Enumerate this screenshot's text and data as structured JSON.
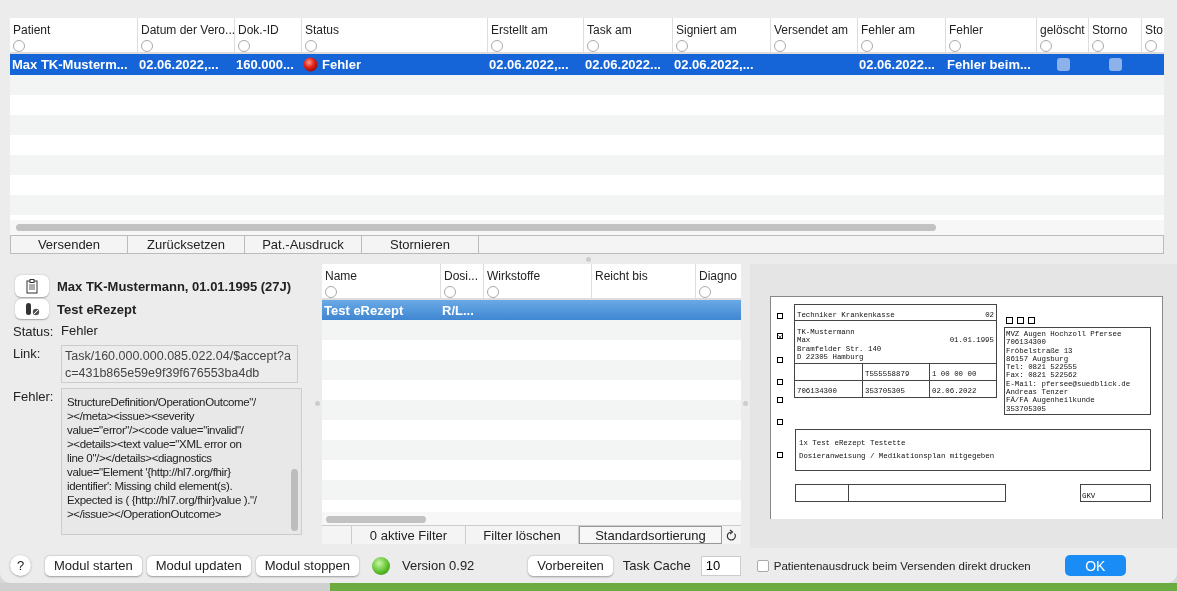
{
  "table": {
    "columns": [
      {
        "label": "Patient",
        "kind": "text",
        "filter_on": false
      },
      {
        "label": "Datum der Vero...",
        "kind": "text",
        "filter_on": false
      },
      {
        "label": "Dok.-ID",
        "kind": "text",
        "filter_on": false
      },
      {
        "label": "Status",
        "kind": "status",
        "filter_on": false
      },
      {
        "label": "Erstellt am",
        "kind": "text",
        "filter_on": false
      },
      {
        "label": "Task am",
        "kind": "text",
        "filter_on": false
      },
      {
        "label": "Signiert am",
        "kind": "text",
        "filter_on": false
      },
      {
        "label": "Versendet am",
        "kind": "text",
        "filter_on": false
      },
      {
        "label": "Fehler am",
        "kind": "text",
        "filter_on": false
      },
      {
        "label": "Fehler",
        "kind": "text",
        "filter_on": false
      },
      {
        "label": "gelöscht",
        "kind": "check",
        "filter_on": false
      },
      {
        "label": "Storno",
        "kind": "check",
        "filter_on": false
      },
      {
        "label": "Sto",
        "kind": "text",
        "filter_on": false
      }
    ],
    "rows": [
      {
        "selected": true,
        "cells": [
          "Max TK-Musterm...",
          "02.06.2022,...",
          "160.000...",
          "Fehler",
          "02.06.2022,...",
          "02.06.2022...",
          "02.06.2022,...",
          null,
          "02.06.2022...",
          "Fehler beim...",
          {
            "checked": false
          },
          {
            "checked": false
          },
          null
        ]
      }
    ]
  },
  "actions": [
    "Versenden",
    "Zurücksetzen",
    "Pat.-Ausdruck",
    "Stornieren"
  ],
  "details": {
    "patient": "Max TK-Mustermann, 01.01.1995 (27J)",
    "prescription": "Test eRezept",
    "status_label": "Status:",
    "status": "Fehler",
    "link_label": "Link:",
    "link": "Task/160.000.000.085.022.04/$accept?ac=431b865e59e9f39f676553ba4db",
    "error_label": "Fehler:",
    "error_lines": [
      "StructureDefinition/OperationOutcome\"/",
      "></meta><issue><severity",
      "value=\"error\"/><code value=\"invalid\"/",
      "><details><text value=\"XML error on",
      "line 0\"/></details><diagnostics",
      "value=\"Element '{http://hl7.org/fhir}",
      "identifier': Missing child element(s).",
      "Expected is ( {http://hl7.org/fhir}value ).\"/",
      "></issue></OperationOutcome>"
    ]
  },
  "items": {
    "columns": [
      {
        "label": "Name",
        "kind": "filter",
        "filter_on": false
      },
      {
        "label": "Dosi...",
        "kind": "filter",
        "filter_on": false
      },
      {
        "label": "Wirkstoffe",
        "kind": "filter",
        "filter_on": false
      },
      {
        "label": "Reicht bis",
        "kind": "plain"
      },
      {
        "label": "Diagno",
        "kind": "filter",
        "filter_on": false
      }
    ],
    "rows": [
      {
        "selected": true,
        "cells": [
          "Test eRezept",
          "R/L..."
        ]
      }
    ],
    "footer": {
      "filters": "0 aktive Filter",
      "clear": "Filter löschen",
      "sort": "Standardsortierung"
    }
  },
  "form": {
    "side_boxes": [
      {
        "checked": false
      },
      {
        "checked": true
      },
      {
        "checked": false
      },
      {
        "checked": false
      },
      {
        "checked": false
      },
      {
        "checked": false
      },
      {
        "checked": false
      }
    ],
    "insurer": "Techniker Krankenkasse",
    "insurer_code": "02",
    "surname": "TK-Mustermann",
    "firstname": "Max",
    "birthdate": "01.01.1995",
    "street": "Bramfelder Str. 140",
    "city": "D 22305 Hamburg",
    "id_row": [
      "T555558879",
      "1 00 00 00"
    ],
    "site_row": [
      "706134300",
      "353705305",
      "02.06.2022"
    ],
    "top_boxes": [
      {
        "checked": false
      },
      {
        "checked": false
      },
      {
        "checked": false
      }
    ],
    "practice_lines": [
      "MVZ Augen Hochzoll Pfersee",
      "706134300",
      "Fröbelstraße  13",
      "86157 Augsburg",
      "Tel: 0821 522555",
      "Fax: 0821 522562",
      "E-Mail: pfersee@suedblick.de",
      "Andreas Tenzer",
      "FÄ/FA Augenheilkunde",
      "353705305"
    ],
    "freetext_lines": [
      "1x Test eRezept Testette",
      "Dosieranweisung / Medikationsplan mitgegeben"
    ],
    "payer_type": "GKV"
  },
  "bottom": {
    "help": "?",
    "modules": [
      "Modul starten",
      "Modul updaten",
      "Modul stoppen"
    ],
    "module_running": true,
    "version": "Version 0.92",
    "prepare": "Vorbereiten",
    "task_cache_label": "Task Cache",
    "task_cache": "10",
    "print_direct": {
      "label": "Patientenausdruck beim Versenden direkt drucken",
      "checked": false
    },
    "ok": "OK"
  }
}
